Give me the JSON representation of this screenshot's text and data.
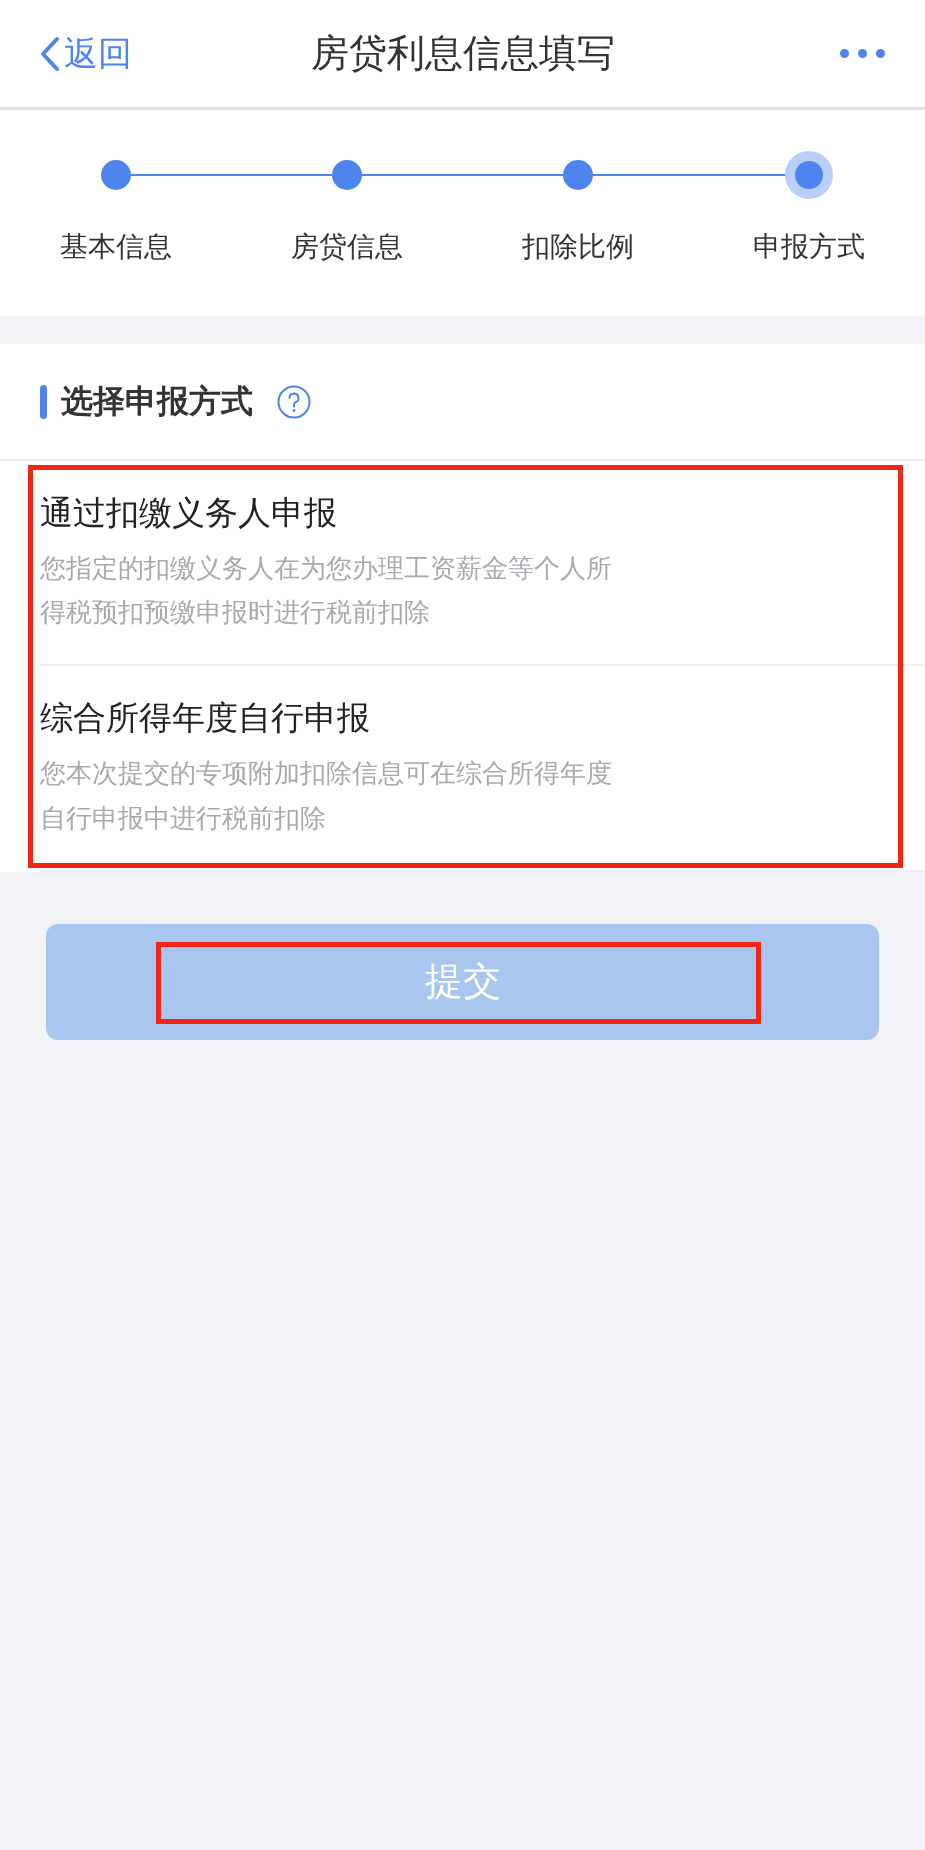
{
  "nav": {
    "back": "返回",
    "title": "房贷利息信息填写"
  },
  "steps": [
    {
      "label": "基本信息",
      "current": false
    },
    {
      "label": "房贷信息",
      "current": false
    },
    {
      "label": "扣除比例",
      "current": false
    },
    {
      "label": "申报方式",
      "current": true
    }
  ],
  "section": {
    "title": "选择申报方式"
  },
  "options": {
    "highlighted": true,
    "items": [
      {
        "title": "通过扣缴义务人申报",
        "description_lines": [
          "您指定的扣缴义务人在为您办理工资薪金等个人所",
          "得税预扣预缴申报时进行税前扣除"
        ]
      },
      {
        "title": "综合所得年度自行申报",
        "description_lines": [
          "您本次提交的专项附加扣除信息可在综合所得年度",
          "自行申报中进行税前扣除"
        ]
      }
    ]
  },
  "submit": {
    "label": "提交",
    "disabled": true,
    "highlighted": true
  }
}
